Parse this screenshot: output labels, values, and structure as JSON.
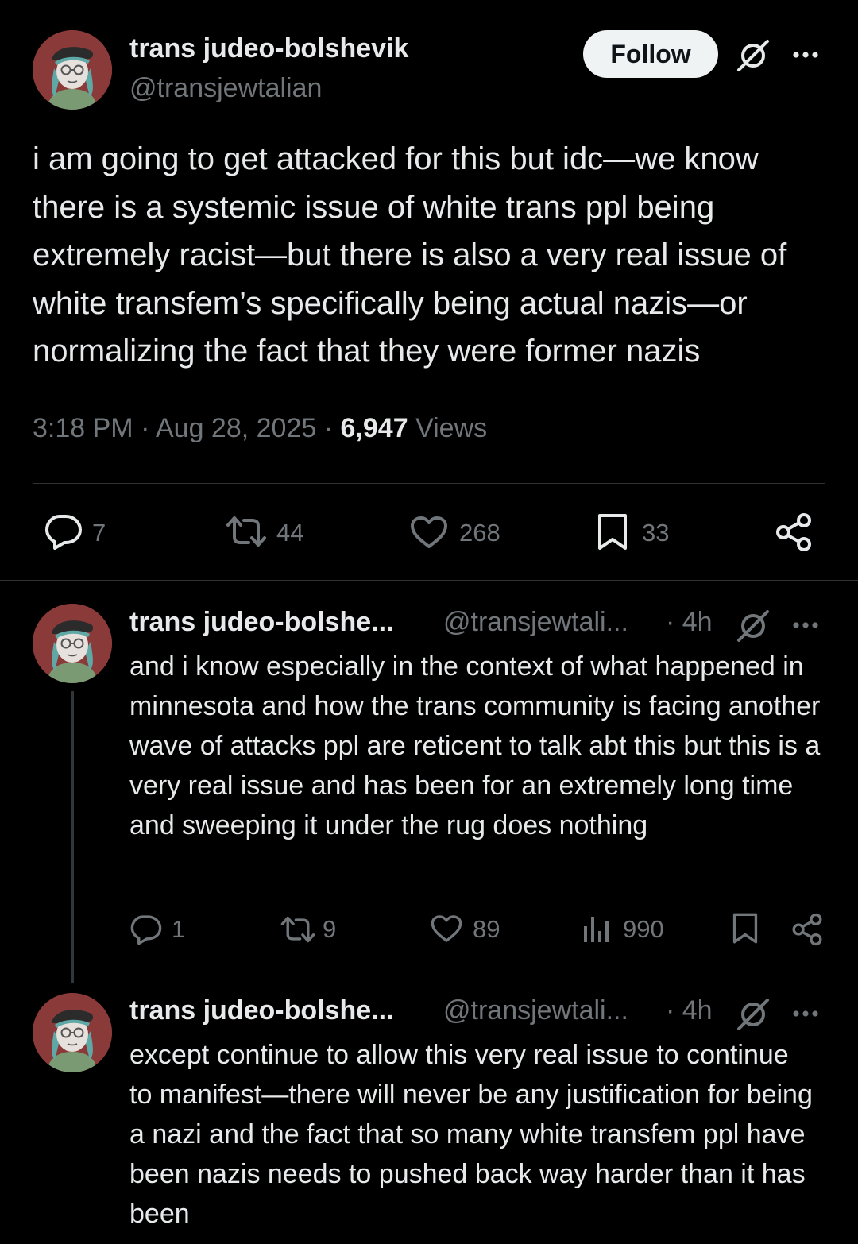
{
  "main_tweet": {
    "display_name": "trans judeo-bolshevik",
    "handle": "@transjewtalian",
    "follow_label": "Follow",
    "text": "i am going to get attacked for this but idc—we know there is a systemic issue of white trans ppl being extremely racist—but there is also a very real issue of white transfem’s specifically being actual nazis—or normalizing the fact that they were former nazis",
    "time": "3:18 PM",
    "date": "Aug 28, 2025",
    "views_count": "6,947",
    "views_label": "Views",
    "replies": "7",
    "reposts": "44",
    "likes": "268",
    "bookmarks": "33"
  },
  "replies": [
    {
      "display_name": "trans judeo-bolshe...",
      "handle": "@transjewtali...",
      "age": "· 4h",
      "text": "and i know especially in the context of what happened in minnesota and how the trans community is facing another wave of attacks ppl are reticent to talk abt this but this is a very real issue and has been for an extremely long time and sweeping it under the rug does nothing",
      "replies": "1",
      "reposts": "9",
      "likes": "89",
      "views": "990"
    },
    {
      "display_name": "trans judeo-bolshe...",
      "handle": "@transjewtali...",
      "age": "· 4h",
      "text": "except continue to allow this very real issue to continue to manifest—there will never be any justification for being a nazi and the fact that so many white transfem ppl have been nazis needs to pushed back way harder than it has been"
    }
  ],
  "icons": {
    "grok": "grok-icon",
    "more": "more-icon",
    "reply": "reply-icon",
    "repost": "repost-icon",
    "like": "heart-icon",
    "bookmark": "bookmark-icon",
    "share": "share-icon",
    "views": "views-icon"
  },
  "colors": {
    "background": "#000000",
    "text": "#e7e9ea",
    "secondary": "#71767b",
    "divider": "#2f3336",
    "follow_bg": "#eff3f4",
    "avatar_bg": "#8a3a38"
  }
}
